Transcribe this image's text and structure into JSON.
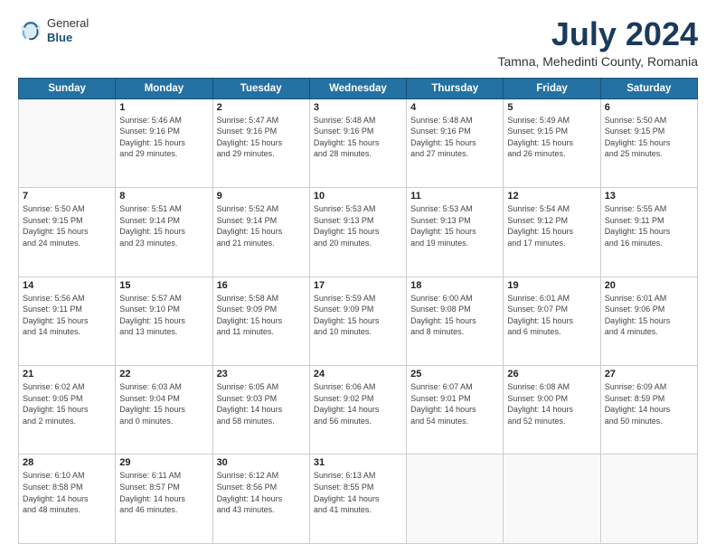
{
  "header": {
    "logo": {
      "line1": "General",
      "line2": "Blue"
    },
    "title": "July 2024",
    "location": "Tamna, Mehedinti County, Romania"
  },
  "days_of_week": [
    "Sunday",
    "Monday",
    "Tuesday",
    "Wednesday",
    "Thursday",
    "Friday",
    "Saturday"
  ],
  "weeks": [
    [
      {
        "day": "",
        "info": ""
      },
      {
        "day": "1",
        "info": "Sunrise: 5:46 AM\nSunset: 9:16 PM\nDaylight: 15 hours\nand 29 minutes."
      },
      {
        "day": "2",
        "info": "Sunrise: 5:47 AM\nSunset: 9:16 PM\nDaylight: 15 hours\nand 29 minutes."
      },
      {
        "day": "3",
        "info": "Sunrise: 5:48 AM\nSunset: 9:16 PM\nDaylight: 15 hours\nand 28 minutes."
      },
      {
        "day": "4",
        "info": "Sunrise: 5:48 AM\nSunset: 9:16 PM\nDaylight: 15 hours\nand 27 minutes."
      },
      {
        "day": "5",
        "info": "Sunrise: 5:49 AM\nSunset: 9:15 PM\nDaylight: 15 hours\nand 26 minutes."
      },
      {
        "day": "6",
        "info": "Sunrise: 5:50 AM\nSunset: 9:15 PM\nDaylight: 15 hours\nand 25 minutes."
      }
    ],
    [
      {
        "day": "7",
        "info": "Sunrise: 5:50 AM\nSunset: 9:15 PM\nDaylight: 15 hours\nand 24 minutes."
      },
      {
        "day": "8",
        "info": "Sunrise: 5:51 AM\nSunset: 9:14 PM\nDaylight: 15 hours\nand 23 minutes."
      },
      {
        "day": "9",
        "info": "Sunrise: 5:52 AM\nSunset: 9:14 PM\nDaylight: 15 hours\nand 21 minutes."
      },
      {
        "day": "10",
        "info": "Sunrise: 5:53 AM\nSunset: 9:13 PM\nDaylight: 15 hours\nand 20 minutes."
      },
      {
        "day": "11",
        "info": "Sunrise: 5:53 AM\nSunset: 9:13 PM\nDaylight: 15 hours\nand 19 minutes."
      },
      {
        "day": "12",
        "info": "Sunrise: 5:54 AM\nSunset: 9:12 PM\nDaylight: 15 hours\nand 17 minutes."
      },
      {
        "day": "13",
        "info": "Sunrise: 5:55 AM\nSunset: 9:11 PM\nDaylight: 15 hours\nand 16 minutes."
      }
    ],
    [
      {
        "day": "14",
        "info": "Sunrise: 5:56 AM\nSunset: 9:11 PM\nDaylight: 15 hours\nand 14 minutes."
      },
      {
        "day": "15",
        "info": "Sunrise: 5:57 AM\nSunset: 9:10 PM\nDaylight: 15 hours\nand 13 minutes."
      },
      {
        "day": "16",
        "info": "Sunrise: 5:58 AM\nSunset: 9:09 PM\nDaylight: 15 hours\nand 11 minutes."
      },
      {
        "day": "17",
        "info": "Sunrise: 5:59 AM\nSunset: 9:09 PM\nDaylight: 15 hours\nand 10 minutes."
      },
      {
        "day": "18",
        "info": "Sunrise: 6:00 AM\nSunset: 9:08 PM\nDaylight: 15 hours\nand 8 minutes."
      },
      {
        "day": "19",
        "info": "Sunrise: 6:01 AM\nSunset: 9:07 PM\nDaylight: 15 hours\nand 6 minutes."
      },
      {
        "day": "20",
        "info": "Sunrise: 6:01 AM\nSunset: 9:06 PM\nDaylight: 15 hours\nand 4 minutes."
      }
    ],
    [
      {
        "day": "21",
        "info": "Sunrise: 6:02 AM\nSunset: 9:05 PM\nDaylight: 15 hours\nand 2 minutes."
      },
      {
        "day": "22",
        "info": "Sunrise: 6:03 AM\nSunset: 9:04 PM\nDaylight: 15 hours\nand 0 minutes."
      },
      {
        "day": "23",
        "info": "Sunrise: 6:05 AM\nSunset: 9:03 PM\nDaylight: 14 hours\nand 58 minutes."
      },
      {
        "day": "24",
        "info": "Sunrise: 6:06 AM\nSunset: 9:02 PM\nDaylight: 14 hours\nand 56 minutes."
      },
      {
        "day": "25",
        "info": "Sunrise: 6:07 AM\nSunset: 9:01 PM\nDaylight: 14 hours\nand 54 minutes."
      },
      {
        "day": "26",
        "info": "Sunrise: 6:08 AM\nSunset: 9:00 PM\nDaylight: 14 hours\nand 52 minutes."
      },
      {
        "day": "27",
        "info": "Sunrise: 6:09 AM\nSunset: 8:59 PM\nDaylight: 14 hours\nand 50 minutes."
      }
    ],
    [
      {
        "day": "28",
        "info": "Sunrise: 6:10 AM\nSunset: 8:58 PM\nDaylight: 14 hours\nand 48 minutes."
      },
      {
        "day": "29",
        "info": "Sunrise: 6:11 AM\nSunset: 8:57 PM\nDaylight: 14 hours\nand 46 minutes."
      },
      {
        "day": "30",
        "info": "Sunrise: 6:12 AM\nSunset: 8:56 PM\nDaylight: 14 hours\nand 43 minutes."
      },
      {
        "day": "31",
        "info": "Sunrise: 6:13 AM\nSunset: 8:55 PM\nDaylight: 14 hours\nand 41 minutes."
      },
      {
        "day": "",
        "info": ""
      },
      {
        "day": "",
        "info": ""
      },
      {
        "day": "",
        "info": ""
      }
    ]
  ]
}
